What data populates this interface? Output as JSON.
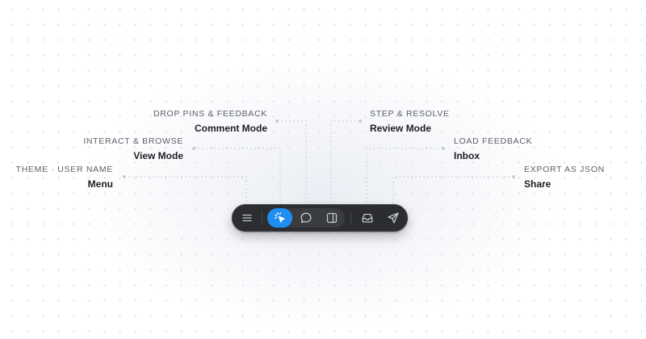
{
  "colors": {
    "toolbar_bg": "#2b2d30",
    "active_mode": "#1f8ef1",
    "caption_text": "#5b5f68",
    "title_text": "#1c1e23",
    "connector": "#c9ccd2"
  },
  "callouts": {
    "comment_mode": {
      "caption": "DROP PINS & FEEDBACK",
      "title": "Comment Mode"
    },
    "view_mode": {
      "caption": "INTERACT & BROWSE",
      "title": "View Mode"
    },
    "menu": {
      "caption": "THEME · USER NAME",
      "title": "Menu"
    },
    "review_mode": {
      "caption": "STEP & RESOLVE",
      "title": "Review Mode"
    },
    "inbox": {
      "caption": "LOAD FEEDBACK",
      "title": "Inbox"
    },
    "share": {
      "caption": "EXPORT AS JSON",
      "title": "Share"
    }
  },
  "toolbar": {
    "menu_icon": "hamburger-menu-icon",
    "view_icon": "cursor-click-icon",
    "comment_icon": "chat-bubble-icon",
    "review_icon": "sidebar-panel-icon",
    "inbox_icon": "inbox-tray-icon",
    "share_icon": "paper-plane-icon",
    "active_mode": "view"
  }
}
